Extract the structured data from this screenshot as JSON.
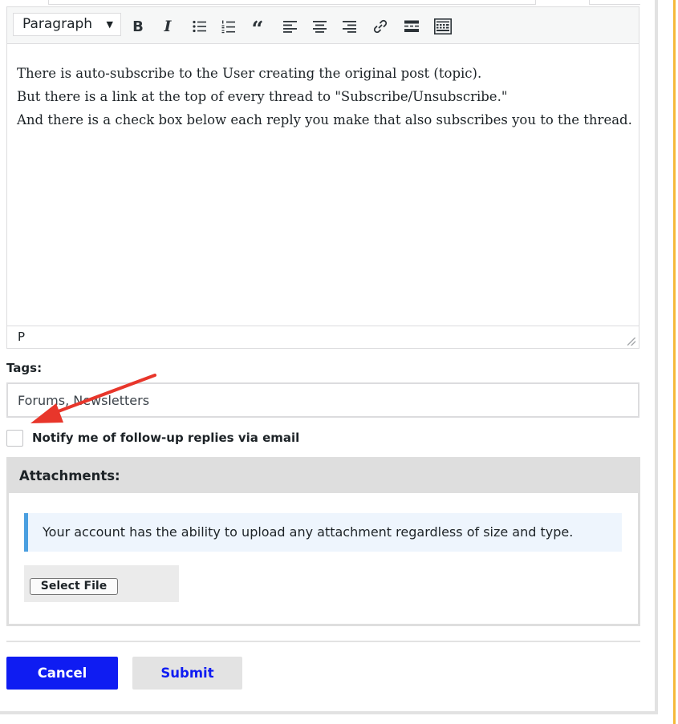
{
  "editor": {
    "format_select": "Paragraph",
    "toolbar_icons": [
      "bold-icon",
      "italic-icon",
      "bullet-list-icon",
      "numbered-list-icon",
      "blockquote-icon",
      "align-left-icon",
      "align-center-icon",
      "align-right-icon",
      "link-icon",
      "read-more-icon",
      "toolbar-toggle-icon"
    ],
    "bold_glyph": "B",
    "italic_glyph": "I",
    "quote_glyph": "“",
    "content": [
      "There is auto-subscribe to the User creating the original post (topic).",
      "But there is a link at the top of every thread to \"Subscribe/Unsubscribe.\"",
      "And there is a check box below each reply you make that also subscribes you to the thread."
    ],
    "status_path": "P"
  },
  "tags": {
    "label": "Tags:",
    "value": "Forums, Newsletters"
  },
  "notify": {
    "label": "Notify me of follow-up replies via email",
    "checked": false
  },
  "attachments": {
    "title": "Attachments:",
    "notice": "Your account has the ability to upload any attachment regardless of size and type.",
    "select_file_label": "Select File"
  },
  "actions": {
    "cancel_label": "Cancel",
    "submit_label": "Submit"
  },
  "colors": {
    "accent_blue": "#0f1cf2",
    "annotation_arrow": "#e8362b",
    "notice_border": "#4a9fe0",
    "side_accent": "#f5b93a"
  }
}
